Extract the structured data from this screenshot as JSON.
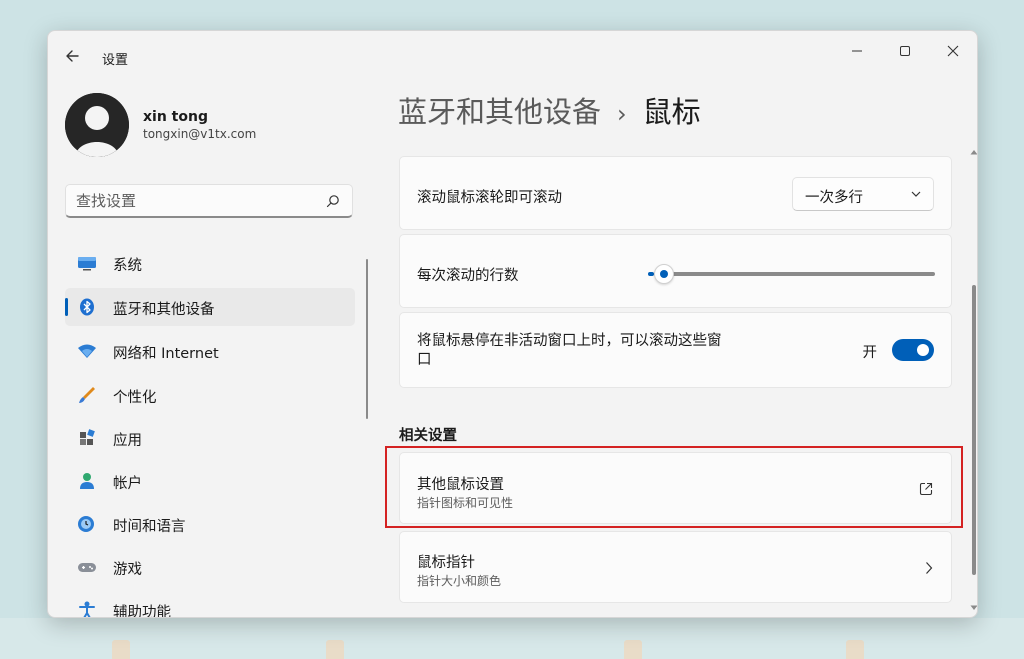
{
  "window": {
    "title": "设置"
  },
  "user": {
    "name": "xin tong",
    "email": "tongxin@v1tx.com"
  },
  "search": {
    "placeholder": "查找设置"
  },
  "sidebar": {
    "items": [
      {
        "label": "系统",
        "icon": "monitor-icon"
      },
      {
        "label": "蓝牙和其他设备",
        "icon": "bluetooth-icon",
        "active": true
      },
      {
        "label": "网络和 Internet",
        "icon": "wifi-icon"
      },
      {
        "label": "个性化",
        "icon": "brush-icon"
      },
      {
        "label": "应用",
        "icon": "apps-icon"
      },
      {
        "label": "帐户",
        "icon": "person-icon"
      },
      {
        "label": "时间和语言",
        "icon": "globe-clock-icon"
      },
      {
        "label": "游戏",
        "icon": "gamepad-icon"
      },
      {
        "label": "辅助功能",
        "icon": "accessibility-icon"
      }
    ]
  },
  "breadcrumb": {
    "parent": "蓝牙和其他设备",
    "separator": "›",
    "current": "鼠标"
  },
  "main": {
    "scroll_mode": {
      "label": "滚动鼠标滚轮即可滚动",
      "value": "一次多行"
    },
    "lines_per_scroll": {
      "label": "每次滚动的行数",
      "level_fraction": 0.02
    },
    "inactive_scroll": {
      "label_line1": "将鼠标悬停在非活动窗口上时，可以滚动这些窗",
      "label_line2": "口",
      "state": "开"
    },
    "related": {
      "title": "相关设置",
      "items": [
        {
          "title": "其他鼠标设置",
          "subtitle": "指针图标和可见性",
          "action": "external-link-icon"
        },
        {
          "title": "鼠标指针",
          "subtitle": "指针大小和颜色",
          "action": "chevron-right-icon"
        }
      ]
    }
  },
  "colors": {
    "accent": "#005fb8",
    "highlight_box": "#d42222",
    "window_bg": "#f3f3f3",
    "card_bg": "#fbfbfb"
  }
}
